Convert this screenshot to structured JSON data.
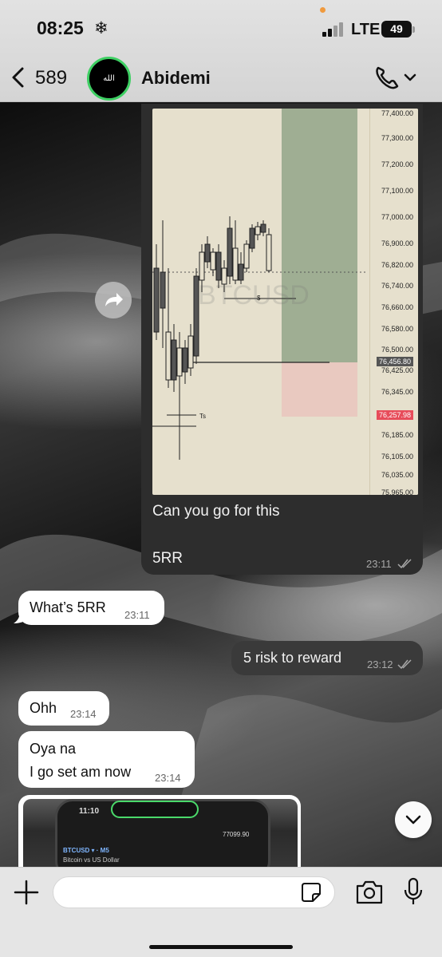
{
  "status_bar": {
    "time": "08:25",
    "time_icon": "snowflake-icon",
    "network": "LTE",
    "battery": "49"
  },
  "header": {
    "back_count": "589",
    "avatar_text": "الله",
    "contact_name": "Abidemi",
    "call_icon": "phone-icon"
  },
  "image_message": {
    "chart_watermark": "BTCUSD",
    "chart_marker_s": "$",
    "chart_marker_ts": "Ts",
    "price_ticks": [
      "77,400.00",
      "77,300.00",
      "77,200.00",
      "77,100.00",
      "77,000.00",
      "76,900.00",
      "76,820.00",
      "76,740.00",
      "76,660.00",
      "76,580.00",
      "76,500.00",
      "76,456.80",
      "76,425.00",
      "76,345.00",
      "76,257.98",
      "76,185.00",
      "76,105.00",
      "76,035.00",
      "75,965.00"
    ],
    "caption_line1": "Can you go for this",
    "caption_line2": "5RR",
    "time": "23:11"
  },
  "messages": [
    {
      "direction": "in",
      "text": "What’s 5RR",
      "time": "23:11"
    },
    {
      "direction": "out",
      "text": "5 risk to reward",
      "time": "23:12"
    },
    {
      "direction": "in",
      "text": "Ohh",
      "time": "23:14"
    },
    {
      "direction": "in",
      "text_line1": "Oya na",
      "text_line2": "I go set am now",
      "time": "23:14"
    }
  ],
  "photo_message": {
    "phone_time": "11:10",
    "ticker": "BTCUSD ▾ · M5",
    "subtitle": "Bitcoin vs US Dollar",
    "price": "77099.90"
  },
  "composer": {
    "placeholder": ""
  },
  "colors": {
    "accent_green": "#3ecf63",
    "bubble_out": "#3a3a3a",
    "bubble_in": "#ffffff",
    "reward_zone": "#9fae93",
    "risk_zone": "#e9c9c0"
  }
}
